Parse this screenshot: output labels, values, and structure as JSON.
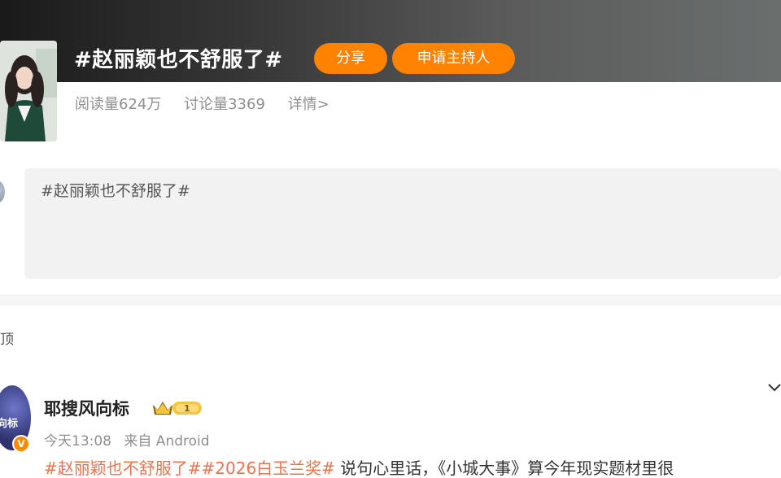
{
  "topic": {
    "title": "#赵丽颖也不舒服了#",
    "share_label": "分享",
    "host_label": "申请主持人",
    "reads": "阅读量624万",
    "discussions": "讨论量3369",
    "detail": "详情>"
  },
  "compose": {
    "text": "#赵丽颖也不舒服了#"
  },
  "feed": {
    "section_label": "顶"
  },
  "post": {
    "author": "耶搜风向标",
    "avatar_text": "向标",
    "verified_badge": "V",
    "level_icon": "crown-level-icon",
    "time": "今天13:08",
    "source": "来自 Android",
    "hashtag1": "#赵丽颖也不舒服了#",
    "hashtag2": "#2026白玉兰奖#",
    "text": " 说句心里话，《小城大事》算今年现实题材里很"
  },
  "colors": {
    "accent": "#ff8200",
    "hashtag": "#eb7350",
    "muted": "#8f8f8f"
  }
}
